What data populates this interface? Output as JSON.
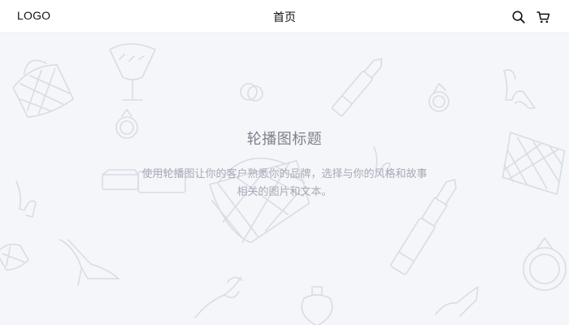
{
  "header": {
    "logo": "LOGO",
    "title": "首页",
    "icons": [
      "search-icon",
      "cart-icon"
    ]
  },
  "hero": {
    "title": "轮播图标题",
    "description": "使用轮播图让你的客户熟悉你的品牌，选择与你的风格和故事相关的图片和文本。",
    "background_pattern": "fashion doodles: lipsticks, high-heel shoes, rings, quilted handbags, perfume bottles"
  },
  "colors": {
    "page_background": "#f5f6fa",
    "header_background": "#ffffff",
    "hero_title": "#7d818c",
    "hero_text": "#a6aab4",
    "doodle_stroke": "#d9dce4"
  }
}
